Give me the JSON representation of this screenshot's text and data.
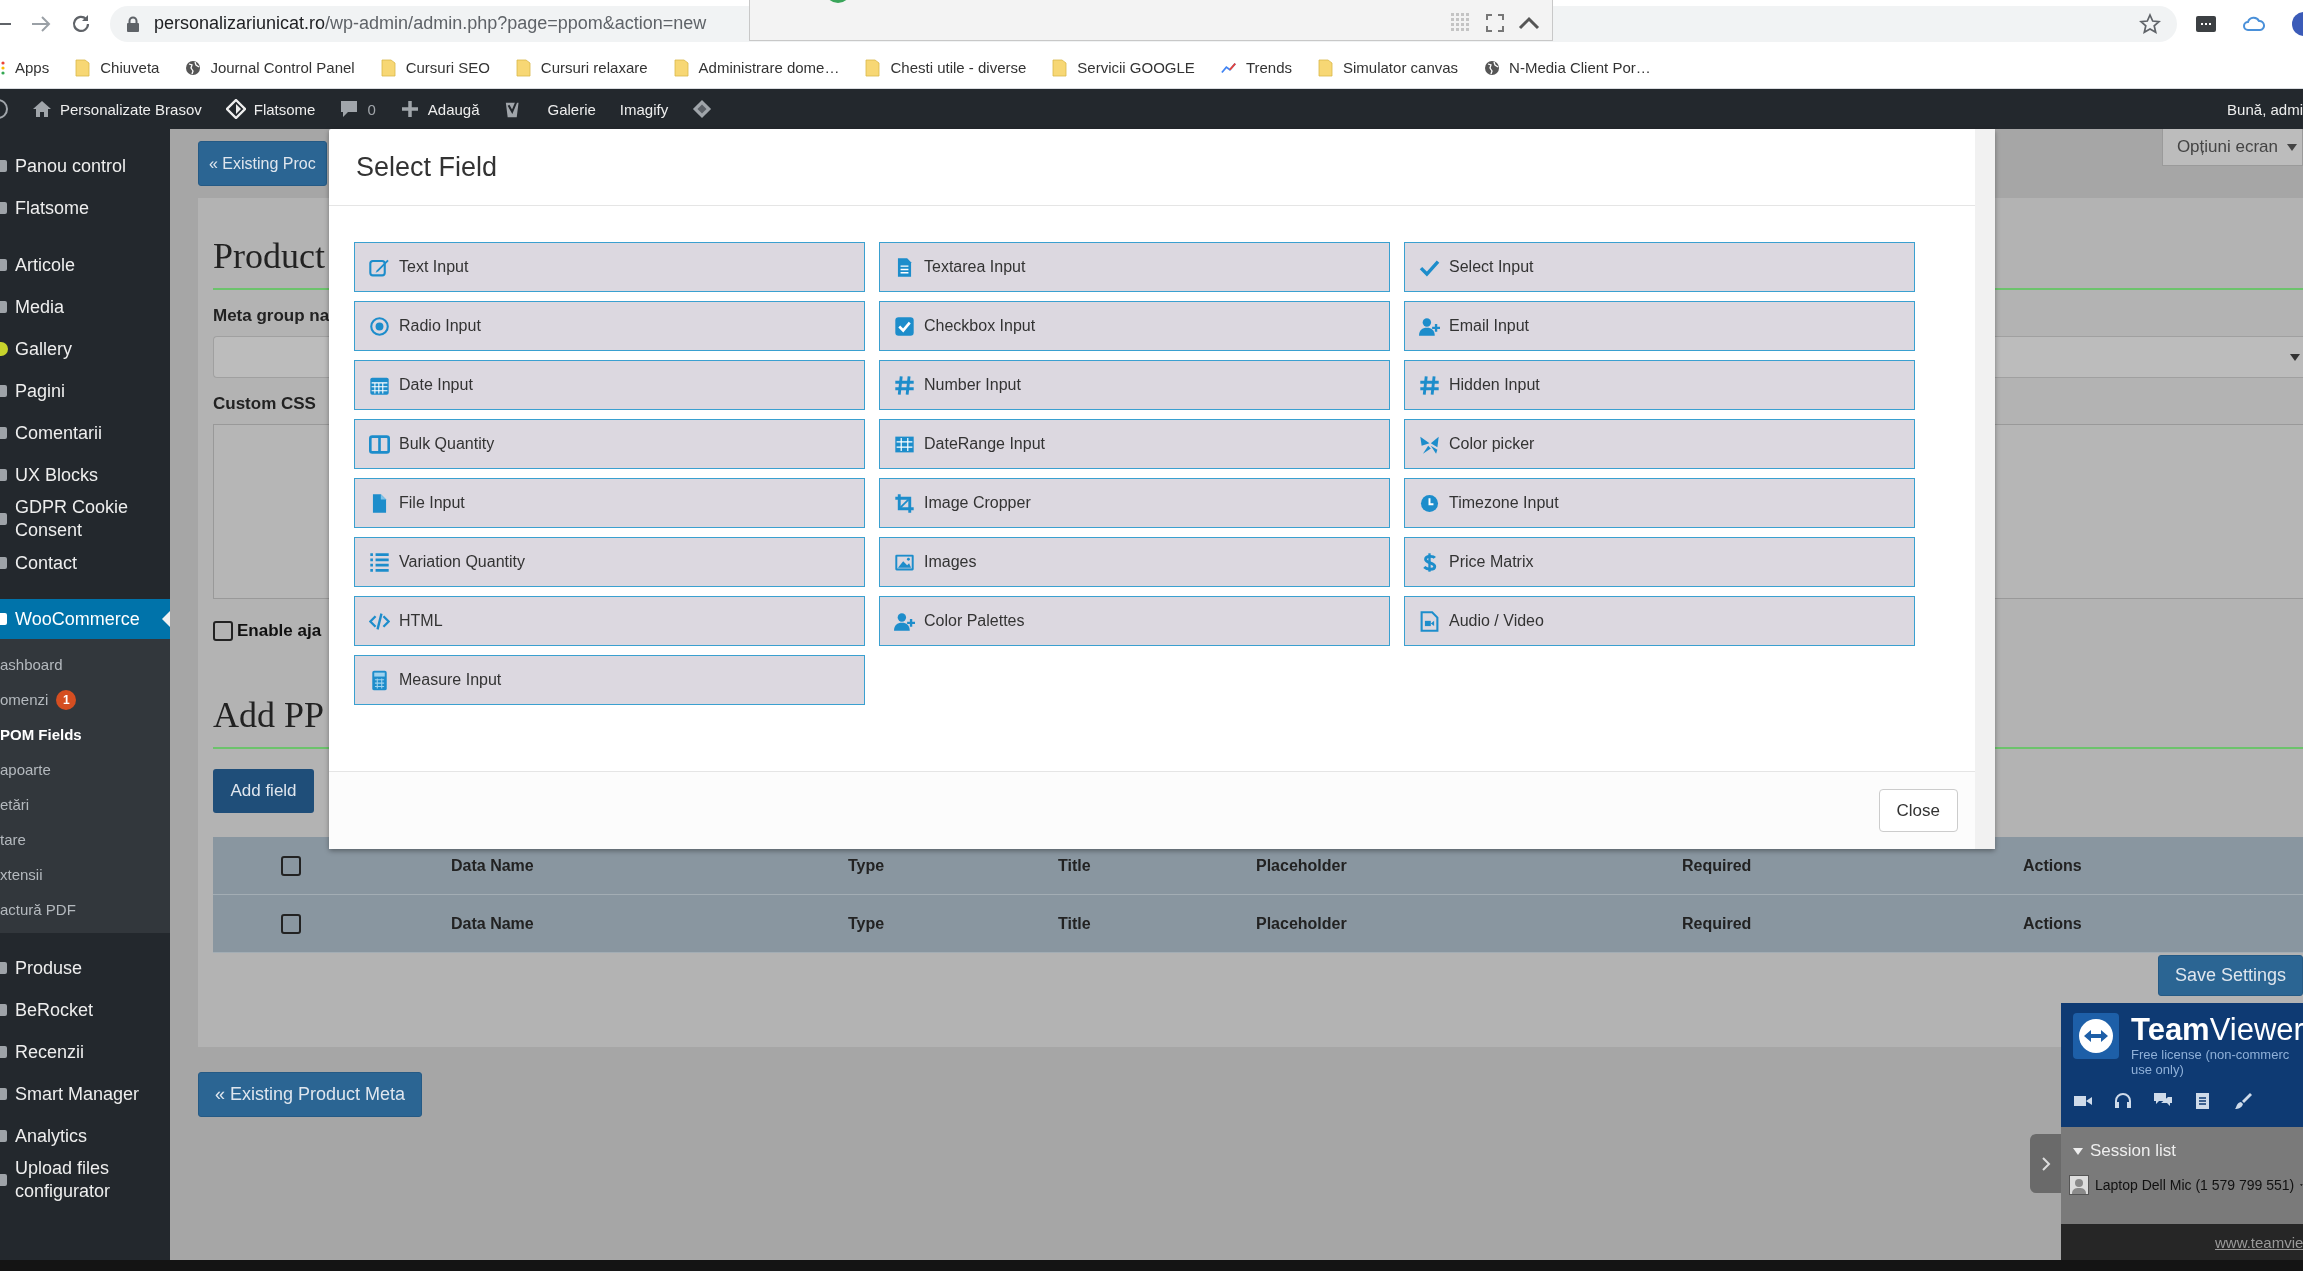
{
  "browser": {
    "url_host": "personalizariunicat.ro",
    "url_path": "/wp-admin/admin.php?page=ppom&action=new"
  },
  "bookmarks": [
    {
      "kind": "apps",
      "label": "Apps"
    },
    {
      "kind": "folder",
      "label": "Chiuveta"
    },
    {
      "kind": "globe",
      "label": "Journal Control Panel"
    },
    {
      "kind": "folder",
      "label": "Cursuri SEO"
    },
    {
      "kind": "folder",
      "label": "Cursuri relaxare"
    },
    {
      "kind": "folder",
      "label": "Administrare dome…"
    },
    {
      "kind": "folder",
      "label": "Chesti utile - diverse"
    },
    {
      "kind": "folder",
      "label": "Servicii GOOGLE"
    },
    {
      "kind": "trends",
      "label": "Trends"
    },
    {
      "kind": "folder",
      "label": "Simulator canvas"
    },
    {
      "kind": "globe",
      "label": "N-Media Client Por…"
    }
  ],
  "admin_bar": {
    "items": [
      {
        "kind": "wp"
      },
      {
        "kind": "home",
        "label": "Personalizate Brasov"
      },
      {
        "kind": "flatsome",
        "label": "Flatsome"
      },
      {
        "kind": "comments",
        "label": "0"
      },
      {
        "kind": "new",
        "label": "Adaugă"
      },
      {
        "kind": "yoast"
      },
      {
        "kind": "text",
        "label": "Galerie"
      },
      {
        "kind": "text",
        "label": "Imagify"
      },
      {
        "kind": "diamond"
      }
    ],
    "greeting": "Bună, admi"
  },
  "sidebar": {
    "groups": [
      {
        "items": [
          {
            "label": "Panou control",
            "selected": false
          },
          {
            "label": "Flatsome",
            "selected": false
          }
        ]
      },
      {
        "items": [
          {
            "label": "Articole",
            "selected": false
          },
          {
            "label": "Media",
            "selected": false
          },
          {
            "label": "Gallery",
            "selected": false
          },
          {
            "label": "Pagini",
            "selected": false
          },
          {
            "label": "Comentarii",
            "selected": false
          },
          {
            "label": "UX Blocks",
            "selected": false
          },
          {
            "label": "GDPR Cookie Consent",
            "selected": false
          },
          {
            "label": "Contact",
            "selected": false
          }
        ]
      },
      {
        "items": [
          {
            "label": "WooCommerce",
            "selected": true,
            "children": [
              {
                "label": "ashboard",
                "selected": false
              },
              {
                "label": "omenzi",
                "badge": "1",
                "selected": false
              },
              {
                "label": "POM Fields",
                "selected": true
              },
              {
                "label": "apoarte",
                "selected": false
              },
              {
                "label": "etări",
                "selected": false
              },
              {
                "label": "tare",
                "selected": false
              },
              {
                "label": "xtensii",
                "selected": false
              },
              {
                "label": "actură PDF",
                "selected": false
              }
            ]
          },
          {
            "label": "Produse",
            "selected": false
          },
          {
            "label": "BeRocket",
            "selected": false
          },
          {
            "label": "Recenzii",
            "selected": false
          },
          {
            "label": "Smart Manager",
            "selected": false
          },
          {
            "label": "Analytics",
            "selected": false
          },
          {
            "label": "Upload files configurator",
            "selected": false
          }
        ]
      }
    ]
  },
  "page": {
    "top_button": "« Existing Proc",
    "screen_options": "Opțiuni ecran",
    "meta_heading": "Product",
    "meta_group_label": "Meta group na",
    "custom_css_label": "Custom CSS",
    "ajax_checkbox": {
      "label": "Enable aja",
      "checked": false
    },
    "fields_heading": "Add PP",
    "add_field_button": "Add field",
    "table_rows": [
      {
        "checked": false,
        "cells": [
          "Data Name",
          "Type",
          "Title",
          "Placeholder",
          "Required",
          "Actions"
        ]
      },
      {
        "checked": false,
        "cells": [
          "Data Name",
          "Type",
          "Title",
          "Placeholder",
          "Required",
          "Actions"
        ]
      }
    ],
    "save_button": "Save Settings",
    "bottom_button": "« Existing Product Meta"
  },
  "modal": {
    "title": "Select Field",
    "fields": [
      "Text Input",
      "Textarea Input",
      "Select Input",
      "Radio Input",
      "Checkbox Input",
      "Email Input",
      "Date Input",
      "Number Input",
      "Hidden Input",
      "Bulk Quantity",
      "DateRange Input",
      "Color picker",
      "File Input",
      "Image Cropper",
      "Timezone Input",
      "Variation Quantity",
      "Images",
      "Price Matrix",
      "HTML",
      "Color Palettes",
      "Audio / Video",
      "Measure Input"
    ],
    "close_button": "Close"
  },
  "teamviewer": {
    "brand": "**Team**Viewer",
    "license": [
      "Free license (non-commerc",
      "use only)"
    ],
    "session_list": "Session list",
    "session_list_expanded": true,
    "device": "Laptop Dell Mic (1 579 799 551)",
    "link": "www.teamvie"
  }
}
